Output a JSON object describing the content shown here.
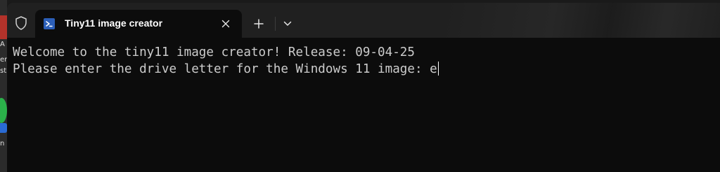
{
  "desktop": {
    "letters": [
      "A",
      "er",
      "st",
      "n"
    ]
  },
  "window": {
    "tab": {
      "title": "Tiny11 image creator",
      "icon": "powershell-icon"
    },
    "controls": {
      "shield_icon": "shield-icon",
      "close_icon": "close-icon",
      "new_tab_icon": "plus-icon",
      "dropdown_icon": "chevron-down-icon"
    }
  },
  "terminal": {
    "lines": [
      "Welcome to the tiny11 image creator! Release: 09-04-25",
      "Please enter the drive letter for the Windows 11 image: e"
    ],
    "text_color": "#cccccc",
    "background": "#0c0c0c"
  }
}
